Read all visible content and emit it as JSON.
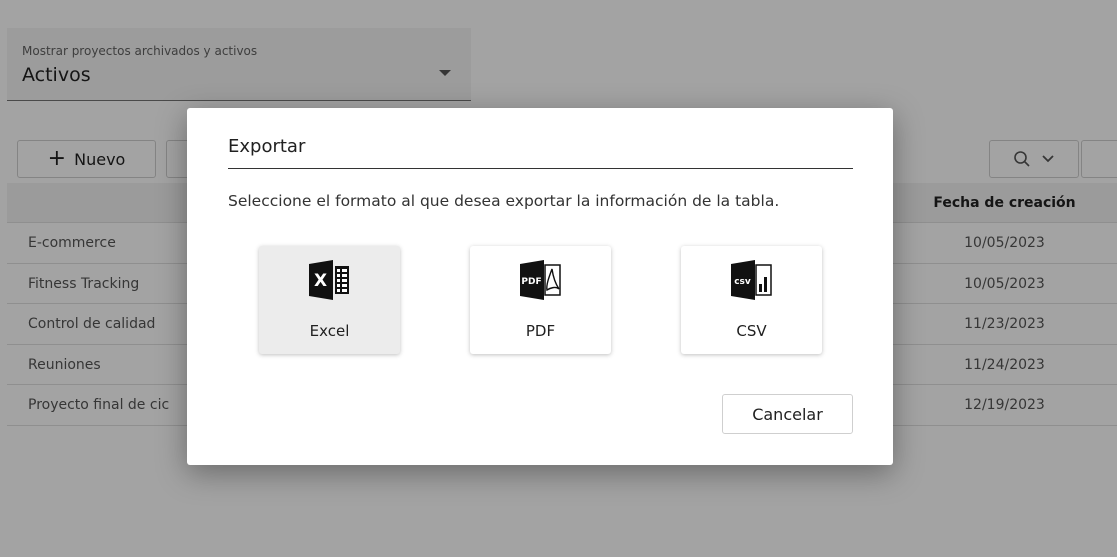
{
  "filter": {
    "label": "Mostrar proyectos archivados y activos",
    "value": "Activos"
  },
  "toolbar": {
    "new_label": "Nuevo"
  },
  "table": {
    "date_header": "Fecha de creación",
    "rows": [
      {
        "name": "E-commerce",
        "date": "10/05/2023"
      },
      {
        "name": "Fitness Tracking",
        "date": "10/05/2023"
      },
      {
        "name": "Control de calidad",
        "date": "11/23/2023"
      },
      {
        "name": "Reuniones",
        "date": "11/24/2023"
      },
      {
        "name": "Proyecto final de cic",
        "date": "12/19/2023"
      }
    ]
  },
  "dialog": {
    "title": "Exportar",
    "message": "Seleccione el formato al que desea exportar la información de la tabla.",
    "options": [
      {
        "label": "Excel",
        "icon": "excel-icon",
        "icon_text": "X",
        "selected": true
      },
      {
        "label": "PDF",
        "icon": "pdf-icon",
        "icon_text": "PDF",
        "selected": false
      },
      {
        "label": "CSV",
        "icon": "csv-icon",
        "icon_text": "csv",
        "selected": false
      }
    ],
    "cancel_label": "Cancelar"
  }
}
